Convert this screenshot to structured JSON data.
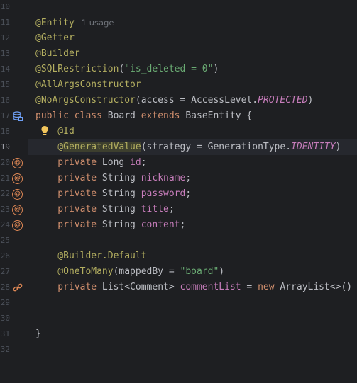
{
  "editor": {
    "usage_hint": "1 usage",
    "lines": [
      {
        "n": "10",
        "tokens": []
      },
      {
        "n": "11",
        "tokens": [
          {
            "t": "@Entity",
            "c": "ann"
          }
        ]
      },
      {
        "n": "12",
        "tokens": [
          {
            "t": "@Getter",
            "c": "ann"
          }
        ]
      },
      {
        "n": "13",
        "tokens": [
          {
            "t": "@Builder",
            "c": "ann"
          }
        ]
      },
      {
        "n": "14",
        "tokens": [
          {
            "t": "@SQLRestriction",
            "c": "ann"
          },
          {
            "t": "(",
            "c": "plain"
          },
          {
            "t": "\"is_deleted = 0\"",
            "c": "str"
          },
          {
            "t": ")",
            "c": "plain"
          }
        ]
      },
      {
        "n": "15",
        "tokens": [
          {
            "t": "@AllArgsConstructor",
            "c": "ann"
          }
        ]
      },
      {
        "n": "16",
        "tokens": [
          {
            "t": "@NoArgsConstructor",
            "c": "ann"
          },
          {
            "t": "(access = AccessLevel.",
            "c": "plain"
          },
          {
            "t": "PROTECTED",
            "c": "const"
          },
          {
            "t": ")",
            "c": "plain"
          }
        ]
      },
      {
        "n": "17",
        "tokens": [
          {
            "t": "public class ",
            "c": "kw"
          },
          {
            "t": "Board ",
            "c": "plain"
          },
          {
            "t": "extends ",
            "c": "kw"
          },
          {
            "t": "BaseEntity {",
            "c": "plain"
          }
        ]
      },
      {
        "n": "18",
        "tokens": [
          {
            "t": "    @Id",
            "c": "ann"
          }
        ]
      },
      {
        "n": "19",
        "tokens": [
          {
            "t": "    @",
            "c": "ann"
          },
          {
            "t": "GeneratedValue",
            "c": "ann hl"
          },
          {
            "t": "(strategy = GenerationType.",
            "c": "plain"
          },
          {
            "t": "IDENTITY",
            "c": "const"
          },
          {
            "t": ")",
            "c": "plain"
          }
        ]
      },
      {
        "n": "20",
        "tokens": [
          {
            "t": "    private ",
            "c": "kw"
          },
          {
            "t": "Long ",
            "c": "plain"
          },
          {
            "t": "id",
            "c": "fld"
          },
          {
            "t": ";",
            "c": "plain"
          }
        ]
      },
      {
        "n": "21",
        "tokens": [
          {
            "t": "    private ",
            "c": "kw"
          },
          {
            "t": "String ",
            "c": "plain"
          },
          {
            "t": "nickname",
            "c": "fld"
          },
          {
            "t": ";",
            "c": "plain"
          }
        ]
      },
      {
        "n": "22",
        "tokens": [
          {
            "t": "    private ",
            "c": "kw"
          },
          {
            "t": "String ",
            "c": "plain"
          },
          {
            "t": "password",
            "c": "fld"
          },
          {
            "t": ";",
            "c": "plain"
          }
        ]
      },
      {
        "n": "23",
        "tokens": [
          {
            "t": "    private ",
            "c": "kw"
          },
          {
            "t": "String ",
            "c": "plain"
          },
          {
            "t": "title",
            "c": "fld"
          },
          {
            "t": ";",
            "c": "plain"
          }
        ]
      },
      {
        "n": "24",
        "tokens": [
          {
            "t": "    private ",
            "c": "kw"
          },
          {
            "t": "String ",
            "c": "plain"
          },
          {
            "t": "content",
            "c": "fld"
          },
          {
            "t": ";",
            "c": "plain"
          }
        ]
      },
      {
        "n": "25",
        "tokens": []
      },
      {
        "n": "26",
        "tokens": [
          {
            "t": "    @Builder.Default",
            "c": "ann"
          }
        ]
      },
      {
        "n": "27",
        "tokens": [
          {
            "t": "    @OneToMany",
            "c": "ann"
          },
          {
            "t": "(mappedBy = ",
            "c": "plain"
          },
          {
            "t": "\"board\"",
            "c": "str"
          },
          {
            "t": ")",
            "c": "plain"
          }
        ]
      },
      {
        "n": "28",
        "tokens": [
          {
            "t": "    private ",
            "c": "kw"
          },
          {
            "t": "List<Comment> ",
            "c": "plain"
          },
          {
            "t": "commentList",
            "c": "fld"
          },
          {
            "t": " = ",
            "c": "plain"
          },
          {
            "t": "new ",
            "c": "kw"
          },
          {
            "t": "ArrayList<>()",
            "c": "plain"
          }
        ]
      },
      {
        "n": "29",
        "tokens": []
      },
      {
        "n": "30",
        "tokens": []
      },
      {
        "n": "31",
        "tokens": [
          {
            "t": "}",
            "c": "plain"
          }
        ]
      },
      {
        "n": "32",
        "tokens": []
      }
    ],
    "current_line": "19",
    "gutter_icons": {
      "17": "database-entity-icon",
      "20": "id-field-icon",
      "21": "column-field-icon",
      "22": "column-field-icon",
      "23": "column-field-icon",
      "24": "column-field-icon",
      "28": "relation-link-icon"
    },
    "bulb_line": "18",
    "colors": {
      "background": "#1e1f22",
      "annotation": "#b3ae60",
      "keyword": "#cf8e6d",
      "string": "#6aab73",
      "field": "#c77dbb",
      "text": "#bcbec4",
      "line_number": "#4b5059",
      "gutter_icon": "#e08855",
      "entity_icon": "#6e9ff5"
    }
  }
}
